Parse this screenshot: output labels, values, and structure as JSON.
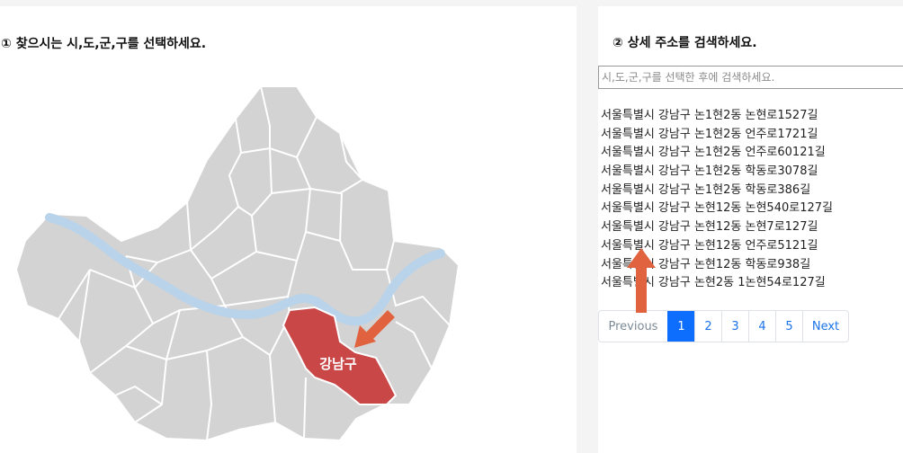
{
  "left_panel": {
    "title": "① 찾으시는 시,도,군,구를 선택하세요.",
    "map": {
      "selected_district": "강남구",
      "selected_color": "#c94747",
      "district_color": "#d3d3d3",
      "river_color": "#b9d3ea"
    }
  },
  "right_panel": {
    "title": "② 상세 주소를 검색하세요.",
    "search_placeholder": "시,도,군,구를 선택한 후에 검색하세요.",
    "results": [
      "서울특별시 강남구 논1현2동 논현로1527길",
      "서울특별시 강남구 논1현2동 언주로1721길",
      "서울특별시 강남구 논1현2동 언주로60121길",
      "서울특별시 강남구 논1현2동 학동로3078길",
      "서울특별시 강남구 논1현2동 학동로386길",
      "서울특별시 강남구 논현12동 논현540로127길",
      "서울특별시 강남구 논현12동 논현7로127길",
      "서울특별시 강남구 논현12동 언주로5121길",
      "서울특별시 강남구 논현12동 학동로938길",
      "서울특별시 강남구 논현2동 1논현54로127길"
    ],
    "pagination": {
      "previous": "Previous",
      "pages": [
        "1",
        "2",
        "3",
        "4",
        "5"
      ],
      "active_page": "1",
      "next": "Next"
    }
  },
  "annotations": {
    "arrow_color": "#e0623f"
  }
}
